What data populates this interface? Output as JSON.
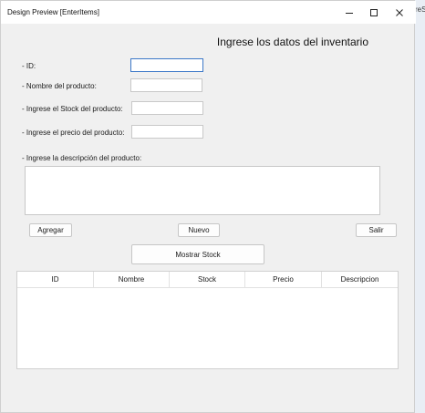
{
  "background": {
    "text": "reS"
  },
  "window": {
    "title": "Design Preview [EnterItems]",
    "controls": {
      "minimize": "minimize-icon",
      "maximize": "maximize-icon",
      "close": "close-icon"
    }
  },
  "form": {
    "heading": "Ingrese los datos del inventario",
    "labels": {
      "id": "- ID:",
      "nombre": "- Nombre del producto:",
      "stock": "- Ingrese el Stock del producto:",
      "precio": "- Ingrese el precio del producto:",
      "descripcion": "- Ingrese la descripción del producto:"
    },
    "values": {
      "id": "",
      "nombre": "",
      "stock": "",
      "precio": "",
      "descripcion": ""
    }
  },
  "buttons": {
    "agregar": "Agregar",
    "nuevo": "Nuevo",
    "salir": "Salir",
    "mostrar_stock": "Mostrar Stock"
  },
  "table": {
    "columns": [
      "ID",
      "Nombre",
      "Stock",
      "Precio",
      "Descripcion"
    ],
    "rows": []
  }
}
